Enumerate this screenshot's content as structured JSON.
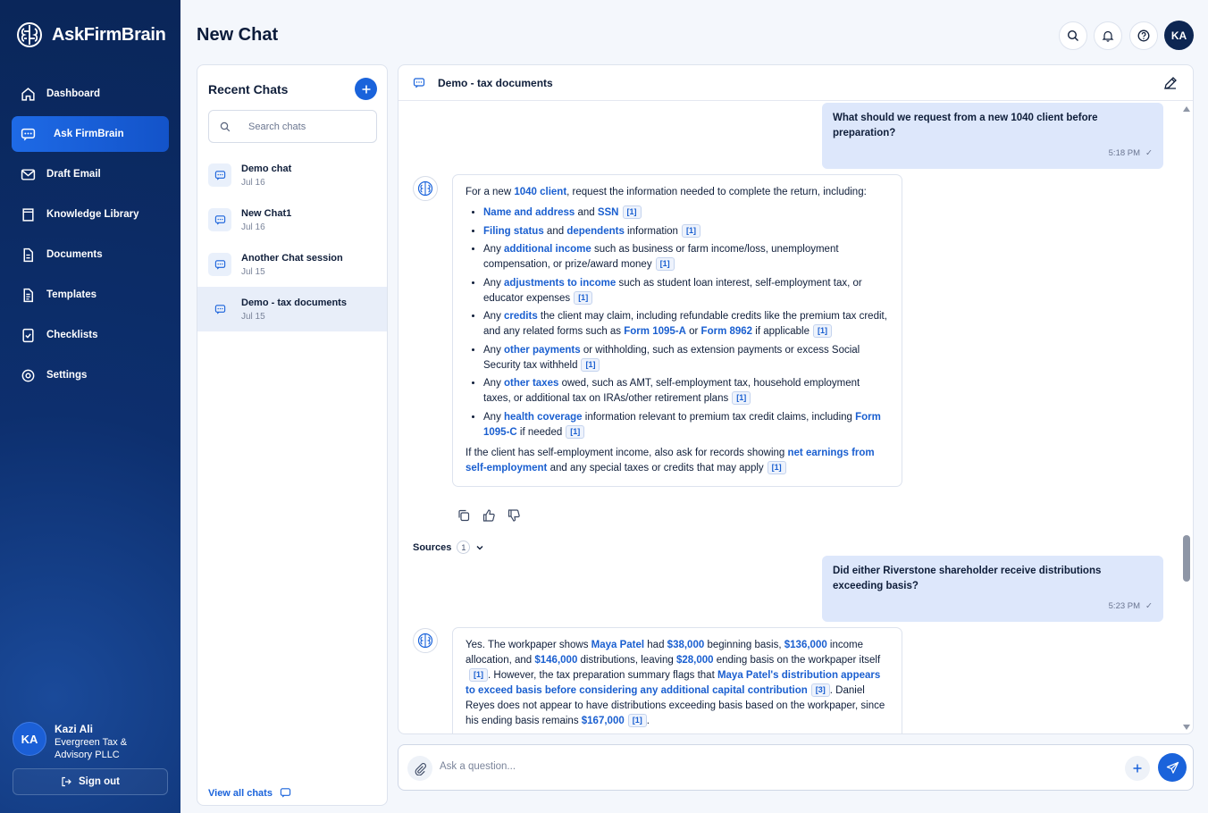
{
  "app": {
    "brand": "AskFirmBrain",
    "page_title": "New Chat"
  },
  "nav": {
    "items": [
      {
        "label": "Dashboard",
        "icon": "home-icon"
      },
      {
        "label": "Ask FirmBrain",
        "icon": "chat-icon",
        "active": true
      },
      {
        "label": "Draft Email",
        "icon": "mail-icon"
      },
      {
        "label": "Knowledge Library",
        "icon": "book-icon"
      },
      {
        "label": "Documents",
        "icon": "document-icon"
      },
      {
        "label": "Templates",
        "icon": "template-icon"
      },
      {
        "label": "Checklists",
        "icon": "checklist-icon"
      },
      {
        "label": "Settings",
        "icon": "gear-icon"
      }
    ]
  },
  "user": {
    "initials": "KA",
    "name": "Kazi Ali",
    "org": "Evergreen Tax & Advisory PLLC",
    "signout": "Sign out"
  },
  "header": {
    "avatar_initials": "KA"
  },
  "recent": {
    "title": "Recent Chats",
    "search_placeholder": "Search chats",
    "chats": [
      {
        "title": "Demo chat",
        "date": "Jul 16"
      },
      {
        "title": "New Chat1",
        "date": "Jul 16"
      },
      {
        "title": "Another Chat session",
        "date": "Jul 15"
      },
      {
        "title": "Demo - tax documents",
        "date": "Jul 15",
        "active": true
      }
    ],
    "view_all": "View all chats"
  },
  "chat": {
    "title": "Demo - tax documents",
    "messages": {
      "q1": {
        "text": "What should we request from a new 1040 client before preparation?",
        "time": "5:18 PM"
      },
      "q2": {
        "text": "Did either Riverstone shareholder receive distributions exceeding basis?",
        "time": "5:23 PM"
      }
    },
    "sources": {
      "label": "Sources",
      "count": "1"
    },
    "input_placeholder": "Ask a question..."
  },
  "colors": {
    "sidebar": "#0a2659",
    "accent": "#1a63db",
    "user_bubble": "#dde7fb",
    "highlight": "#1a5fd0"
  }
}
